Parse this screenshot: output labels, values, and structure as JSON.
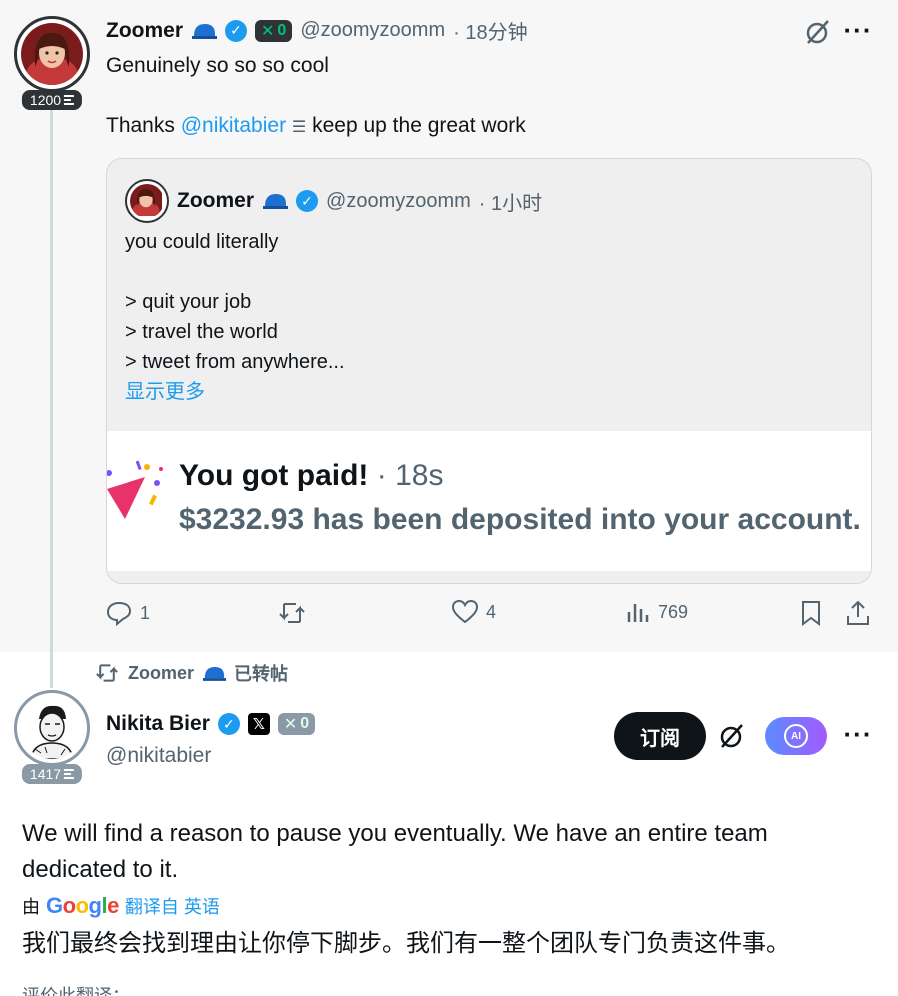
{
  "top_tweet": {
    "score": "1200",
    "display_name": "Zoomer",
    "x_badge_count": "0",
    "handle": "@zoomyzoomm",
    "time": "· 18分钟",
    "text_line1": "Genuinely so so so cool",
    "text_thanks": "Thanks",
    "mention": "@nikitabier",
    "text_rest": "keep up the great work",
    "quote": {
      "display_name": "Zoomer",
      "handle": "@zoomyzoomm",
      "time": "· 1小时",
      "line1": "you could literally",
      "line2": "> quit your job",
      "line3": "> travel the world",
      "line4": "> tweet from anywhere...",
      "show_more": "显示更多",
      "media": {
        "title": "You got paid!",
        "time": "· 18s",
        "amount": "$3232.93 has been deposited into your account."
      }
    },
    "actions": {
      "replies": "1",
      "likes": "4",
      "views": "769"
    }
  },
  "retweet_label": {
    "name": "Zoomer",
    "action": "已转帖"
  },
  "nikita": {
    "score": "1417",
    "display_name": "Nikita Bier",
    "x_badge_count": "0",
    "handle": "@nikitabier",
    "subscribe_label": "订阅",
    "grok_label": "AI",
    "text": "We will find a reason to pause you eventually. We have an entire team dedicated to it.",
    "translate_by": "由",
    "google": "Google",
    "translate_from": "翻译自 英语",
    "translated_text": "我们最终会找到理由让你停下脚步。我们有一整个团队专门负责这件事。",
    "rate_translation": "评价此翻译："
  },
  "colors": {
    "accent": "#1d9bf0",
    "background_top": "#f7f7f7",
    "muted": "#536471"
  }
}
